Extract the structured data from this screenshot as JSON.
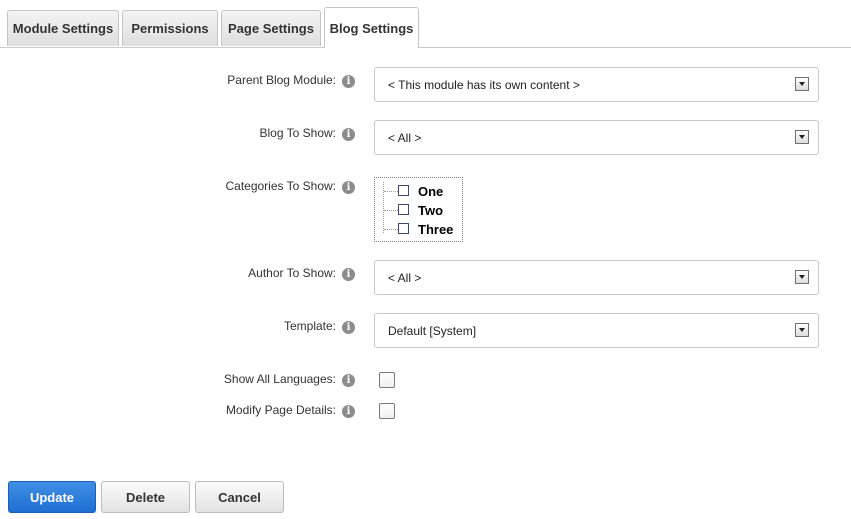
{
  "tabs": [
    {
      "label": "Module Settings",
      "active": false
    },
    {
      "label": "Permissions",
      "active": false
    },
    {
      "label": "Page Settings",
      "active": false
    },
    {
      "label": "Blog Settings",
      "active": true
    }
  ],
  "form": {
    "parent_blog_module": {
      "label": "Parent Blog Module:",
      "value": "< This module has its own content >"
    },
    "blog_to_show": {
      "label": "Blog To Show:",
      "value": "< All >"
    },
    "categories_to_show": {
      "label": "Categories To Show:",
      "items": [
        {
          "label": "One",
          "checked": false
        },
        {
          "label": "Two",
          "checked": false
        },
        {
          "label": "Three",
          "checked": false
        }
      ]
    },
    "author_to_show": {
      "label": "Author To Show:",
      "value": "< All >"
    },
    "template": {
      "label": "Template:",
      "value": "Default [System]"
    },
    "show_all_languages": {
      "label": "Show All Languages:",
      "checked": false
    },
    "modify_page_details": {
      "label": "Modify Page Details:",
      "checked": false
    }
  },
  "info_icon_glyph": "i",
  "buttons": {
    "update": "Update",
    "delete": "Delete",
    "cancel": "Cancel"
  },
  "colors": {
    "primary_button": "#2a7ddb",
    "info_icon": "#8c8c8c"
  }
}
